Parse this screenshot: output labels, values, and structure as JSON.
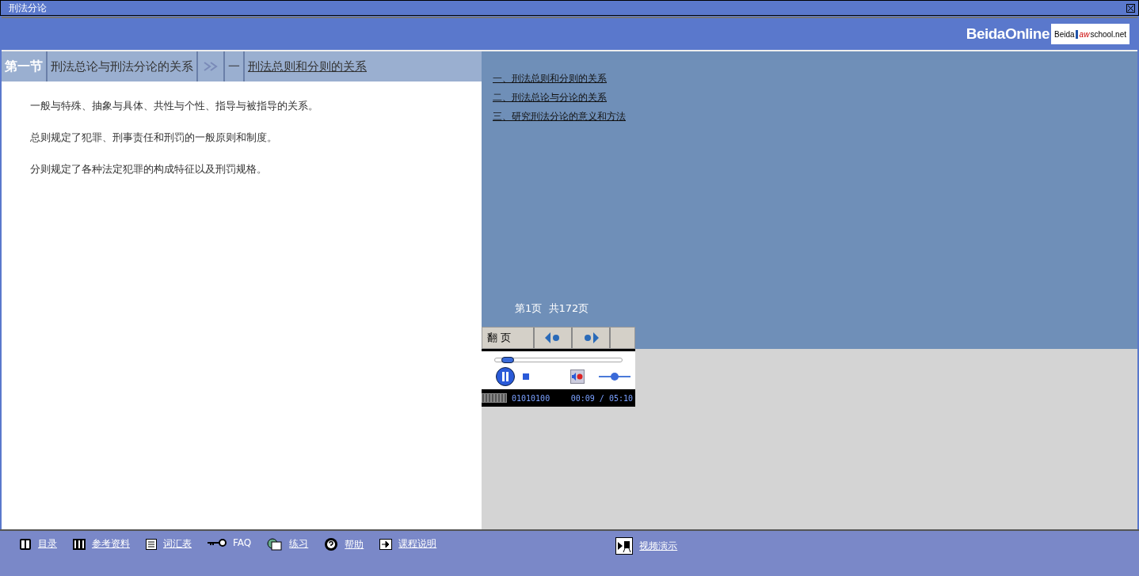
{
  "window": {
    "title": "刑法分论"
  },
  "header": {
    "logo_main": "BeidaOnline",
    "logo_box": [
      "Beida",
      "aw",
      "school.net"
    ]
  },
  "breadcrumb": [
    {
      "text": "第一节",
      "kind": "section"
    },
    {
      "text": "刑法总论与刑法分论的关系",
      "kind": "title"
    },
    {
      "kind": "arrows"
    },
    {
      "text": "一",
      "kind": "number"
    },
    {
      "text": "刑法总则和分则的关系",
      "kind": "link"
    }
  ],
  "content": [
    "一般与特殊、抽象与具体、共性与个性、指导与被指导的关系。",
    "总则规定了犯罪、刑事责任和刑罚的一般原则和制度。",
    "分则规定了各种法定犯罪的构成特征以及刑罚规格。"
  ],
  "outline": [
    "一、刑法总则和分则的关系",
    "二、刑法总论与分论的关系",
    "三、研究刑法分论的意义和方法"
  ],
  "pager": {
    "info": "第1页  共172页",
    "label": "翻 页"
  },
  "player": {
    "playing": true,
    "progress": {
      "level": 0.05
    },
    "volume": {
      "level": 0.5
    },
    "muted": true,
    "status": "01010100",
    "time": "00:09 / 05:10"
  },
  "footer": [
    {
      "label": "目录",
      "kind": "book"
    },
    {
      "label": "参考资料",
      "kind": "piano"
    },
    {
      "label": "词汇表",
      "kind": "list"
    },
    {
      "label": "FAQ",
      "kind": "key"
    },
    {
      "label": "练习",
      "kind": "cards"
    },
    {
      "label": "帮助",
      "kind": "help"
    },
    {
      "label": "课程说明",
      "kind": "arrow"
    },
    {
      "label": "视频演示",
      "kind": "video"
    }
  ]
}
